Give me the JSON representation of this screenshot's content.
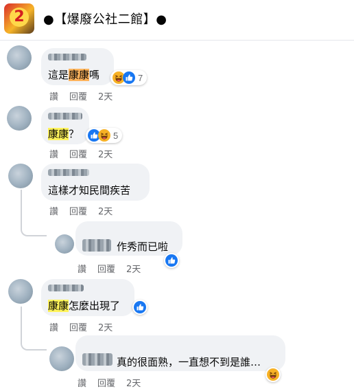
{
  "group": {
    "logo_text": "2",
    "title": "●【爆廢公社二館】●"
  },
  "comments": [
    {
      "text_a": "這是",
      "text_hl": "康康",
      "text_b": "嗎",
      "reaction_count": "7",
      "actions": {
        "like": "讚",
        "reply": "回覆",
        "time": "2天"
      }
    },
    {
      "text_hl": "康康",
      "text_b": "？",
      "reaction_count": "5",
      "actions": {
        "like": "讚",
        "reply": "回覆",
        "time": "2天"
      }
    },
    {
      "text_b": "這樣才知民間疾苦",
      "actions": {
        "like": "讚",
        "reply": "回覆",
        "time": "2天"
      }
    },
    {
      "text_b": "作秀而已啦",
      "actions": {
        "like": "讚",
        "reply": "回覆",
        "time": "2天"
      }
    },
    {
      "text_hl": "康康",
      "text_b": "怎麼出現了",
      "actions": {
        "like": "讚",
        "reply": "回覆",
        "time": "2天"
      }
    },
    {
      "text_b": "真的很面熟，一直想不到是誰…",
      "actions": {
        "like": "讚",
        "reply": "回覆",
        "time": "2天"
      }
    }
  ],
  "icons": {
    "like": "thumbs-up-icon",
    "haha": "laughing-face-icon"
  },
  "colors": {
    "like_blue": "#1877f2",
    "haha_yellow": "#f7b125",
    "highlight_yellow": "#fff35a",
    "highlight_orange": "#ffb35c"
  }
}
